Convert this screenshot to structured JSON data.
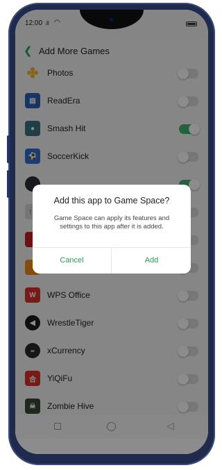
{
  "status_bar": {
    "time": "12:00",
    "signal": "ᵢll",
    "wifi": "wifi-icon",
    "battery": "battery-icon"
  },
  "header": {
    "title": "Add More Games",
    "back_icon": "back-arrow-icon"
  },
  "apps": [
    {
      "label": "Photos",
      "icon": "photos-pinwheel-icon",
      "color": "#f3b431",
      "enabled": false
    },
    {
      "label": "ReadEra",
      "icon": "readera-book-icon",
      "color": "#2d5fb4",
      "enabled": false
    },
    {
      "label": "Smash Hit",
      "icon": "smash-hit-icon",
      "color": "#3d6f80",
      "enabled": true
    },
    {
      "label": "SoccerKick",
      "icon": "soccerkick-icon",
      "color": "#2f6fcf",
      "enabled": false
    },
    {
      "label": "",
      "icon": "game-icon",
      "color": "#2c2c3a",
      "enabled": true
    },
    {
      "label": "",
      "icon": "game-icon",
      "color": "#d8d8d8",
      "enabled": false
    },
    {
      "label": "",
      "icon": "game-icon",
      "color": "#c3222a",
      "enabled": false
    },
    {
      "label": "",
      "icon": "game-icon",
      "color": "#f08a1c",
      "enabled": false
    },
    {
      "label": "WPS Office",
      "icon": "wps-office-icon",
      "color": "#d8322b",
      "enabled": false
    },
    {
      "label": "WrestleTiger",
      "icon": "wrestletiger-icon",
      "color": "#1c1c1c",
      "enabled": false
    },
    {
      "label": "xCurrency",
      "icon": "xcurrency-icon",
      "color": "#2a2a2a",
      "enabled": false
    },
    {
      "label": "YiQiFu",
      "icon": "yiqifu-icon",
      "color": "#d8322b",
      "enabled": false
    },
    {
      "label": "Zombie Hive",
      "icon": "zombie-hive-icon",
      "color": "#3a4a38",
      "enabled": false
    }
  ],
  "dialog": {
    "title": "Add this app to Game Space?",
    "message": "Game Space can apply its features and settings to this app after it is added.",
    "cancel_label": "Cancel",
    "add_label": "Add"
  },
  "colors": {
    "accent": "#1e9e58",
    "toggle_on": "#3fb36f",
    "toggle_off": "#d9d9d9"
  }
}
